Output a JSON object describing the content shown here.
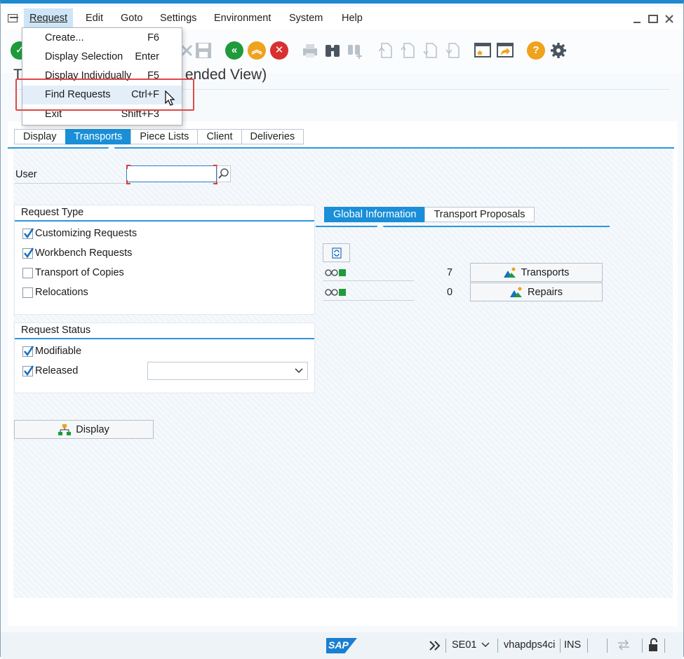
{
  "menubar": {
    "items": [
      "Request",
      "Edit",
      "Goto",
      "Settings",
      "Environment",
      "System",
      "Help"
    ]
  },
  "dropdown": {
    "items": [
      {
        "label": "Create...",
        "shortcut": "F6"
      },
      {
        "label": "Display Selection",
        "shortcut": "Enter"
      },
      {
        "label": "Display Individually",
        "shortcut": "F5"
      },
      {
        "label": "Find Requests",
        "shortcut": "Ctrl+F"
      },
      {
        "label": "Exit",
        "shortcut": "Shift+F3"
      }
    ],
    "highlighted": "Find Requests"
  },
  "title": {
    "prefix": "T",
    "suffix": "ended View)"
  },
  "tabs": [
    "Display",
    "Transports",
    "Piece Lists",
    "Client",
    "Deliveries"
  ],
  "selected_tab": "Transports",
  "user": {
    "label": "User",
    "value": ""
  },
  "request_type": {
    "title": "Request Type",
    "items": [
      {
        "label": "Customizing Requests",
        "checked": true
      },
      {
        "label": "Workbench Requests",
        "checked": true
      },
      {
        "label": "Transport of Copies",
        "checked": false
      },
      {
        "label": "Relocations",
        "checked": false
      }
    ]
  },
  "request_status": {
    "title": "Request Status",
    "items": [
      {
        "label": "Modifiable",
        "checked": true
      },
      {
        "label": "Released",
        "checked": true
      }
    ],
    "released_select": ""
  },
  "display_button": "Display",
  "info_tabs": [
    "Global Information",
    "Transport Proposals"
  ],
  "info": {
    "rows": [
      {
        "count": "7",
        "button": "Transports"
      },
      {
        "count": "0",
        "button": "Repairs"
      }
    ]
  },
  "statusbar": {
    "logo": "SAP",
    "system": "SE01",
    "server": "vhapdps4ci",
    "mode": "INS"
  },
  "colors": {
    "accent": "#1a8fd8",
    "highlight_box": "#e04848",
    "ok_green": "#1f9a3c",
    "cancel_red": "#d8302f",
    "orange": "#f0a21c"
  }
}
